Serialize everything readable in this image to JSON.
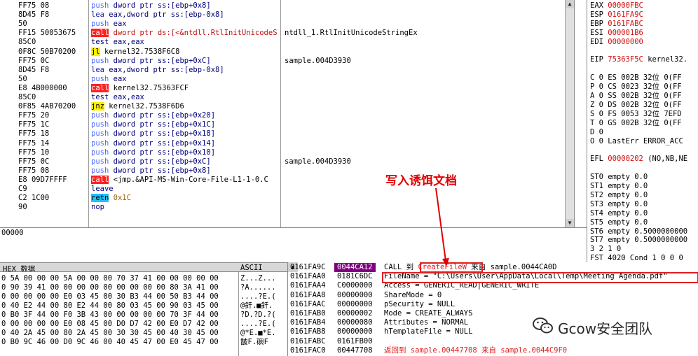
{
  "disassembly": {
    "rows": [
      {
        "bytes": "FF75 08",
        "mn": "push",
        "op": "dword ptr ss:[ebp+0x8]",
        "cmt": "",
        "kind": "push",
        "opc": "navy"
      },
      {
        "bytes": "8D45 F8",
        "mn": "lea",
        "op": "eax,dword ptr ss:[ebp-0x8]",
        "cmt": "",
        "kind": "lea",
        "opc": "navy"
      },
      {
        "bytes": "50",
        "mn": "push",
        "op": "eax",
        "cmt": "",
        "kind": "push",
        "opc": "navy"
      },
      {
        "bytes": "FF15 50053675",
        "mn": "call",
        "op": "dword ptr ds:[<&ntdll.RtlInitUnicodeS",
        "cmt": "ntdll_1.RtlInitUnicodeStringEx",
        "kind": "call",
        "opc": "red"
      },
      {
        "bytes": "85C0",
        "mn": "test",
        "op": "eax,eax",
        "cmt": "",
        "kind": "test",
        "opc": "navy"
      },
      {
        "bytes": "0F8C 50B70200",
        "mn": "jl",
        "op": "kernel32.7538F6C8",
        "cmt": "",
        "kind": "jcc",
        "opc": "black"
      },
      {
        "bytes": "FF75 0C",
        "mn": "push",
        "op": "dword ptr ss:[ebp+0xC]",
        "cmt": "sample.004D3930",
        "kind": "push",
        "opc": "navy"
      },
      {
        "bytes": "8D45 F8",
        "mn": "lea",
        "op": "eax,dword ptr ss:[ebp-0x8]",
        "cmt": "",
        "kind": "lea",
        "opc": "navy"
      },
      {
        "bytes": "50",
        "mn": "push",
        "op": "eax",
        "cmt": "",
        "kind": "push",
        "opc": "navy"
      },
      {
        "bytes": "E8 4B000000",
        "mn": "call",
        "op": "kernel32.75363FCF",
        "cmt": "",
        "kind": "call",
        "opc": "black"
      },
      {
        "bytes": "85C0",
        "mn": "test",
        "op": "eax,eax",
        "cmt": "",
        "kind": "test",
        "opc": "navy"
      },
      {
        "bytes": "0F85 4AB70200",
        "mn": "jnz",
        "op": "kernel32.7538F6D6",
        "cmt": "",
        "kind": "jcc",
        "opc": "black"
      },
      {
        "bytes": "FF75 20",
        "mn": "push",
        "op": "dword ptr ss:[ebp+0x20]",
        "cmt": "",
        "kind": "push",
        "opc": "navy"
      },
      {
        "bytes": "FF75 1C",
        "mn": "push",
        "op": "dword ptr ss:[ebp+0x1C]",
        "cmt": "",
        "kind": "push",
        "opc": "navy"
      },
      {
        "bytes": "FF75 18",
        "mn": "push",
        "op": "dword ptr ss:[ebp+0x18]",
        "cmt": "",
        "kind": "push",
        "opc": "navy"
      },
      {
        "bytes": "FF75 14",
        "mn": "push",
        "op": "dword ptr ss:[ebp+0x14]",
        "cmt": "",
        "kind": "push",
        "opc": "navy"
      },
      {
        "bytes": "FF75 10",
        "mn": "push",
        "op": "dword ptr ss:[ebp+0x10]",
        "cmt": "",
        "kind": "push",
        "opc": "navy"
      },
      {
        "bytes": "FF75 0C",
        "mn": "push",
        "op": "dword ptr ss:[ebp+0xC]",
        "cmt": "sample.004D3930",
        "kind": "push",
        "opc": "navy"
      },
      {
        "bytes": "FF75 08",
        "mn": "push",
        "op": "dword ptr ss:[ebp+0x8]",
        "cmt": "",
        "kind": "push",
        "opc": "navy"
      },
      {
        "bytes": "E8 09D7FFFF",
        "mn": "call",
        "op": "<jmp.&API-MS-Win-Core-File-L1-1-0.C",
        "cmt": "",
        "kind": "call",
        "opc": "black"
      },
      {
        "bytes": "C9",
        "mn": "leave",
        "op": "",
        "cmt": "",
        "kind": "leave",
        "opc": "navy"
      },
      {
        "bytes": "C2 1C00",
        "mn": "retn",
        "op": "0x1C",
        "cmt": "",
        "kind": "ret",
        "opc": "olive"
      },
      {
        "bytes": "90",
        "mn": "nop",
        "op": "",
        "cmt": "",
        "kind": "leave",
        "opc": "navy"
      }
    ]
  },
  "info": {
    "text": "00000"
  },
  "registers": {
    "rows": [
      {
        "name": "EAX",
        "val": "00000FBC",
        "extra": ""
      },
      {
        "name": "ESP",
        "val": "0161FA9C",
        "extra": ""
      },
      {
        "name": "EBP",
        "val": "0161FABC",
        "extra": ""
      },
      {
        "name": "ESI",
        "val": "000001B6",
        "extra": ""
      },
      {
        "name": "EDI",
        "val": "00000000",
        "extra": ""
      },
      {
        "name": "",
        "val": "",
        "extra": ""
      },
      {
        "name": "EIP",
        "val": "75363F5C",
        "extra": "kernel32."
      },
      {
        "name": "",
        "val": "",
        "extra": ""
      },
      {
        "name": "C 0",
        "val": "",
        "extra": "ES 002B 32位 0(FF"
      },
      {
        "name": "P 0",
        "val": "",
        "extra": "CS 0023 32位 0(FF"
      },
      {
        "name": "A 0",
        "val": "",
        "extra": "SS 002B 32位 0(FF"
      },
      {
        "name": "Z 0",
        "val": "",
        "extra": "DS 002B 32位 0(FF"
      },
      {
        "name": "S 0",
        "val": "",
        "extra": "FS 0053 32位 7EFD"
      },
      {
        "name": "T 0",
        "val": "",
        "extra": "GS 002B 32位 0(FF"
      },
      {
        "name": "D 0",
        "val": "",
        "extra": ""
      },
      {
        "name": "O 0",
        "val": "",
        "extra": "LastErr ERROR_ACC"
      },
      {
        "name": "",
        "val": "",
        "extra": ""
      },
      {
        "name": "EFL",
        "val": "00000202",
        "extra": "(NO,NB,NE"
      },
      {
        "name": "",
        "val": "",
        "extra": ""
      },
      {
        "name": "ST0",
        "val": "",
        "extra": "empty 0.0"
      },
      {
        "name": "ST1",
        "val": "",
        "extra": "empty 0.0"
      },
      {
        "name": "ST2",
        "val": "",
        "extra": "empty 0.0"
      },
      {
        "name": "ST3",
        "val": "",
        "extra": "empty 0.0"
      },
      {
        "name": "ST4",
        "val": "",
        "extra": "empty 0.0"
      },
      {
        "name": "ST5",
        "val": "",
        "extra": "empty 0.0"
      },
      {
        "name": "ST6",
        "val": "",
        "extra": "empty 0.5000000000"
      },
      {
        "name": "ST7",
        "val": "",
        "extra": "empty 0.5000000000"
      },
      {
        "name": "",
        "val": "",
        "extra": "3 2 1 0"
      },
      {
        "name": "FST",
        "val": "",
        "extra": "4020  Cond 1 0 0 0"
      }
    ]
  },
  "hex": {
    "header_hex": "HEX 数据",
    "header_ascii": "ASCII",
    "rows": [
      {
        "b": "0 5A 00 00 00 5A 00 00 00 70 37 41 00 00 00 00 00",
        "a": "Z...Z..."
      },
      {
        "b": "0 90 39 41 00 00 00 00 00 00 00 00 00 80 3A 41 00",
        "a": "?A......"
      },
      {
        "b": "0 00 00 00 00 E0 03 45 00 30 B3 44 00 50 B3 44 00",
        "a": "....?E.("
      },
      {
        "b": "0 40 E2 44 00 80 E2 44 00 80 03 45 00 90 03 45 00",
        "a": "@釬.■釬."
      },
      {
        "b": "0 B0 3F 44 00 F0 3B 43 00 00 00 00 00 70 3F 44 00",
        "a": "?D.?D.?("
      },
      {
        "b": "0 00 00 00 00 E0 08 45 00 D0 D7 42 00 E0 D7 42 00",
        "a": "....?E.("
      },
      {
        "b": "0 40 2A 45 00 80 2A 45 00 30 30 45 00 40 30 45 00",
        "a": "@*E.■*E."
      },
      {
        "b": "0 B0 9C 46 00 D0 9C 46 00 40 45 47 00 E0 45 47 00",
        "a": "皵F.礖F"
      }
    ]
  },
  "stack": {
    "rows": [
      {
        "addr": "0161FA9C",
        "val": "0044CA12",
        "com_pre": "CALL 到 ",
        "com_api": "CreateFileW",
        "com_post": " 来自 sample.0044CA0D"
      },
      {
        "addr": "0161FAA0",
        "val": "0181C6DC",
        "com_pre": "FileName = \"C:\\Users\\User\\AppData\\Local\\Temp\\Meeting Agenda.pdf\"",
        "com_api": "",
        "com_post": ""
      },
      {
        "addr": "0161FAA4",
        "val": "C0000000",
        "com_pre": "Access = GENERIC_READ|GENERIC_WRITE",
        "com_api": "",
        "com_post": ""
      },
      {
        "addr": "0161FAA8",
        "val": "00000000",
        "com_pre": "ShareMode = 0",
        "com_api": "",
        "com_post": ""
      },
      {
        "addr": "0161FAAC",
        "val": "00000000",
        "com_pre": "pSecurity = NULL",
        "com_api": "",
        "com_post": ""
      },
      {
        "addr": "0161FAB0",
        "val": "00000002",
        "com_pre": "Mode = CREATE_ALWAYS",
        "com_api": "",
        "com_post": ""
      },
      {
        "addr": "0161FAB4",
        "val": "00000080",
        "com_pre": "Attributes = NORMAL",
        "com_api": "",
        "com_post": ""
      },
      {
        "addr": "0161FAB8",
        "val": "00000000",
        "com_pre": "hTemplateFile = NULL",
        "com_api": "",
        "com_post": ""
      },
      {
        "addr": "0161FABC",
        "val": "0161FB00",
        "com_pre": "",
        "com_api": "",
        "com_post": ""
      },
      {
        "addr": "0161FAC0",
        "val": "00447708",
        "com_pre": "返回到 sample.00447708 来自 sample.0044C9F0",
        "com_api": "",
        "com_post": ""
      }
    ]
  },
  "annotation": {
    "text": "写入诱饵文档"
  },
  "watermark": {
    "text": "Gcow安全团队"
  },
  "colors": {
    "call_bg": "#ff2020",
    "jcc_bg": "#ffee00",
    "ret_bg": "#20c0ff",
    "push": "#4a6aff",
    "reg_red": "#d01010",
    "stack_sel": "#800080",
    "annot_red": "#e00000"
  }
}
